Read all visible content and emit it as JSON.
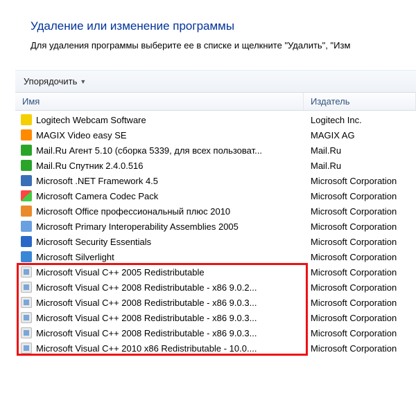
{
  "heading": "Удаление или изменение программы",
  "subheading": "Для удаления программы выберите ее в списке и щелкните \"Удалить\", \"Изм",
  "toolbar": {
    "organize": "Упорядочить"
  },
  "columns": {
    "name": "Имя",
    "publisher": "Издатель"
  },
  "rows": [
    {
      "icon": "ic-logi",
      "name": "Logitech Webcam Software",
      "publisher": "Logitech Inc."
    },
    {
      "icon": "ic-magix",
      "name": "MAGIX Video easy SE",
      "publisher": "MAGIX AG"
    },
    {
      "icon": "ic-mru1",
      "name": "Mail.Ru Агент 5.10 (сборка 5339, для всех пользоват...",
      "publisher": "Mail.Ru"
    },
    {
      "icon": "ic-mru2",
      "name": "Mail.Ru Спутник 2.4.0.516",
      "publisher": "Mail.Ru"
    },
    {
      "icon": "ic-net",
      "name": "Microsoft .NET Framework 4.5",
      "publisher": "Microsoft Corporation"
    },
    {
      "icon": "ic-win",
      "name": "Microsoft Camera Codec Pack",
      "publisher": "Microsoft Corporation"
    },
    {
      "icon": "ic-off",
      "name": "Microsoft Office профессиональный плюс 2010",
      "publisher": "Microsoft Corporation"
    },
    {
      "icon": "ic-pia",
      "name": "Microsoft Primary Interoperability Assemblies 2005",
      "publisher": "Microsoft Corporation"
    },
    {
      "icon": "ic-mse",
      "name": "Microsoft Security Essentials",
      "publisher": "Microsoft Corporation"
    },
    {
      "icon": "ic-sl",
      "name": "Microsoft Silverlight",
      "publisher": "Microsoft Corporation"
    },
    {
      "icon": "ic-vc",
      "name": "Microsoft Visual C++ 2005 Redistributable",
      "publisher": "Microsoft Corporation"
    },
    {
      "icon": "ic-vc",
      "name": "Microsoft Visual C++ 2008 Redistributable - x86 9.0.2...",
      "publisher": "Microsoft Corporation"
    },
    {
      "icon": "ic-vc",
      "name": "Microsoft Visual C++ 2008 Redistributable - x86 9.0.3...",
      "publisher": "Microsoft Corporation"
    },
    {
      "icon": "ic-vc",
      "name": "Microsoft Visual C++ 2008 Redistributable - x86 9.0.3...",
      "publisher": "Microsoft Corporation"
    },
    {
      "icon": "ic-vc",
      "name": "Microsoft Visual C++ 2008 Redistributable - x86 9.0.3...",
      "publisher": "Microsoft Corporation"
    },
    {
      "icon": "ic-vc",
      "name": "Microsoft Visual C++ 2010  x86 Redistributable - 10.0....",
      "publisher": "Microsoft Corporation"
    }
  ],
  "highlight": {
    "firstRow": 10,
    "lastRow": 15
  }
}
